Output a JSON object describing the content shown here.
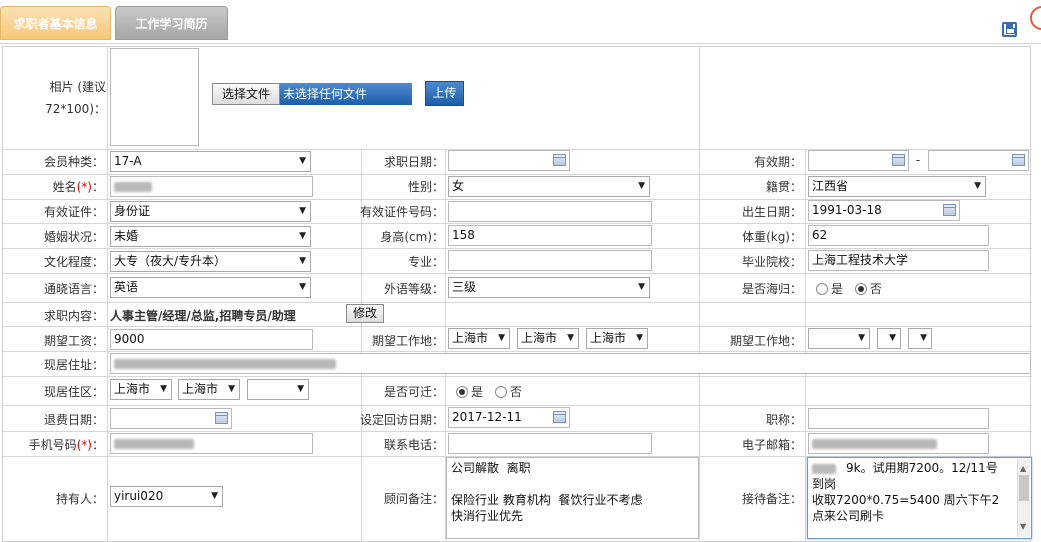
{
  "tabs": [
    {
      "label": "求职者基本信息",
      "active": true
    },
    {
      "label": "工作学习简历",
      "active": false
    }
  ],
  "photo": {
    "label": "相片 (建议",
    "label2": "72*100)：",
    "choose_file": "选择文件",
    "no_file": "未选择任何文件",
    "upload": "上传"
  },
  "labels": {
    "member_type": "会员种类：",
    "apply_date": "求职日期：",
    "valid_period": "有效期：",
    "name": "姓名",
    "name_req": "(*)",
    "name_colon": "：",
    "gender": "性别：",
    "native": "籍贯：",
    "id_type": "有效证件：",
    "id_no": "有效证件号码：",
    "birth": "出生日期：",
    "marital": "婚姻状况：",
    "height": "身高(cm)：",
    "weight": "体重(kg)：",
    "education": "文化程度：",
    "major": "专业：",
    "school": "毕业院校：",
    "language": "通晓语言：",
    "lang_level": "外语等级：",
    "returnee": "是否海归：",
    "job_content": "求职内容：",
    "salary": "期望工资：",
    "work_place": "期望工作地：",
    "work_place2": "期望工作地：",
    "address": "现居住址：",
    "district": "现居住区：",
    "relocate": "是否可迁：",
    "refund_date": "退费日期：",
    "visit_date": "设定回访日期：",
    "title": "职称：",
    "mobile": "手机号码",
    "mobile_req": "(*)",
    "mobile_colon": "：",
    "phone": "联系电话：",
    "email": "电子邮箱：",
    "holder": "持有人：",
    "consultant_note": "顾问备注：",
    "reception_note": "接待备注："
  },
  "values": {
    "member_type": "17-A",
    "gender": "女",
    "native": "江西省",
    "id_type": "身份证",
    "birth": "1991-03-18",
    "marital": "未婚",
    "height": "158",
    "weight": "62",
    "education": "大专（夜大/专升本）",
    "school": "上海工程技术大学",
    "language": "英语",
    "lang_level": "三级",
    "returnee_yes": "是",
    "returnee_no": "否",
    "job_content": "人事主管/经理/总监,招聘专员/助理",
    "modify": "修改",
    "salary": "9000",
    "work_city1": "上海市",
    "work_city2": "上海市",
    "work_city3": "上海市",
    "district_city1": "上海市",
    "district_city2": "上海市",
    "relocate_yes": "是",
    "relocate_no": "否",
    "visit_date": "2017-12-11",
    "holder": "yirui020",
    "consultant_note": "公司解散  离职\n\n保险行业 教育机构  餐饮行业不考虑\n快消行业优先",
    "reception_note_text": "9k。试用期7200。12/11号\n到岗\n收取7200*0.75=5400 周六下午2\n点来公司刷卡",
    "valid_dash": "-"
  }
}
